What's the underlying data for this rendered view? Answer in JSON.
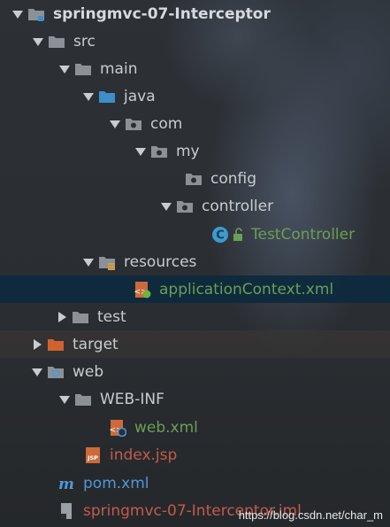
{
  "tree": {
    "items": [
      {
        "label": "springmvc-07-Interceptor",
        "icon": "project-folder-icon"
      },
      {
        "label": "src",
        "icon": "folder-icon"
      },
      {
        "label": "main",
        "icon": "folder-icon"
      },
      {
        "label": "java",
        "icon": "source-folder-icon"
      },
      {
        "label": "com",
        "icon": "package-icon"
      },
      {
        "label": "my",
        "icon": "package-icon"
      },
      {
        "label": "config",
        "icon": "package-icon"
      },
      {
        "label": "controller",
        "icon": "package-icon"
      },
      {
        "label": "TestController",
        "icon": "java-class-icon"
      },
      {
        "label": "resources",
        "icon": "resources-folder-icon"
      },
      {
        "label": "applicationContext.xml",
        "icon": "spring-xml-icon"
      },
      {
        "label": "test",
        "icon": "folder-icon"
      },
      {
        "label": "target",
        "icon": "excluded-folder-icon"
      },
      {
        "label": "web",
        "icon": "web-folder-icon"
      },
      {
        "label": "WEB-INF",
        "icon": "folder-icon"
      },
      {
        "label": "web.xml",
        "icon": "web-xml-icon"
      },
      {
        "label": "index.jsp",
        "icon": "jsp-icon"
      },
      {
        "label": "pom.xml",
        "icon": "maven-icon"
      },
      {
        "label": "springmvc-07-Interceptor.iml",
        "icon": "iml-file-icon"
      }
    ]
  },
  "watermark": "https://blog.csdn.net/char_m",
  "colors": {
    "selection": "#0d293e",
    "green_text": "#6a9f54",
    "red_text": "#c45a4a",
    "folder": "#8b9196",
    "source_folder": "#3c8fc8",
    "excluded_folder": "#d0622f"
  }
}
